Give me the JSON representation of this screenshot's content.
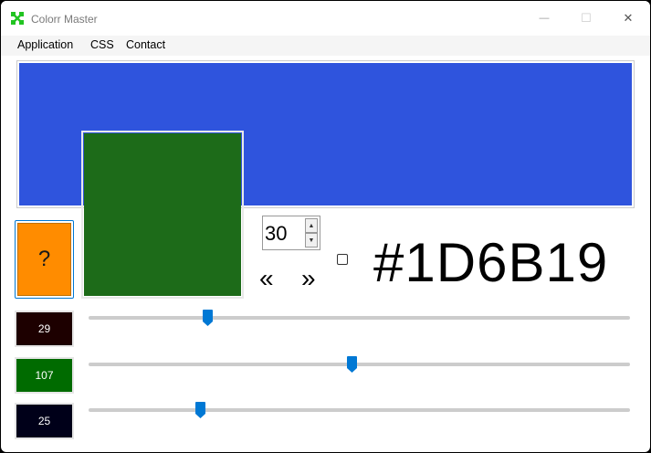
{
  "window": {
    "title": "Colorr Master",
    "minimize_glyph": "—",
    "maximize_glyph": "☐",
    "close_glyph": "✕"
  },
  "menu": {
    "items": [
      "Application",
      "CSS",
      "Contact"
    ]
  },
  "colors": {
    "preview_background": "#2F54DD",
    "current_color": "#1D6B19",
    "random_button": "#FF8C00",
    "red_channel_swatch": "#1D0000",
    "green_channel_swatch": "#006B00",
    "blue_channel_swatch": "#000019",
    "slider_thumb": "#0078D4"
  },
  "random_button": {
    "label": "?"
  },
  "stepper": {
    "value": "30"
  },
  "nav": {
    "prev": "«",
    "next": "»"
  },
  "checkbox": {
    "checked": false
  },
  "hex_code": "#1D6B19",
  "channels": [
    {
      "name": "red",
      "label": "29",
      "value": 29,
      "max": 255
    },
    {
      "name": "green",
      "label": "107",
      "value": 107,
      "max": 255
    },
    {
      "name": "blue",
      "label": "25",
      "value": 25,
      "max": 255
    }
  ]
}
